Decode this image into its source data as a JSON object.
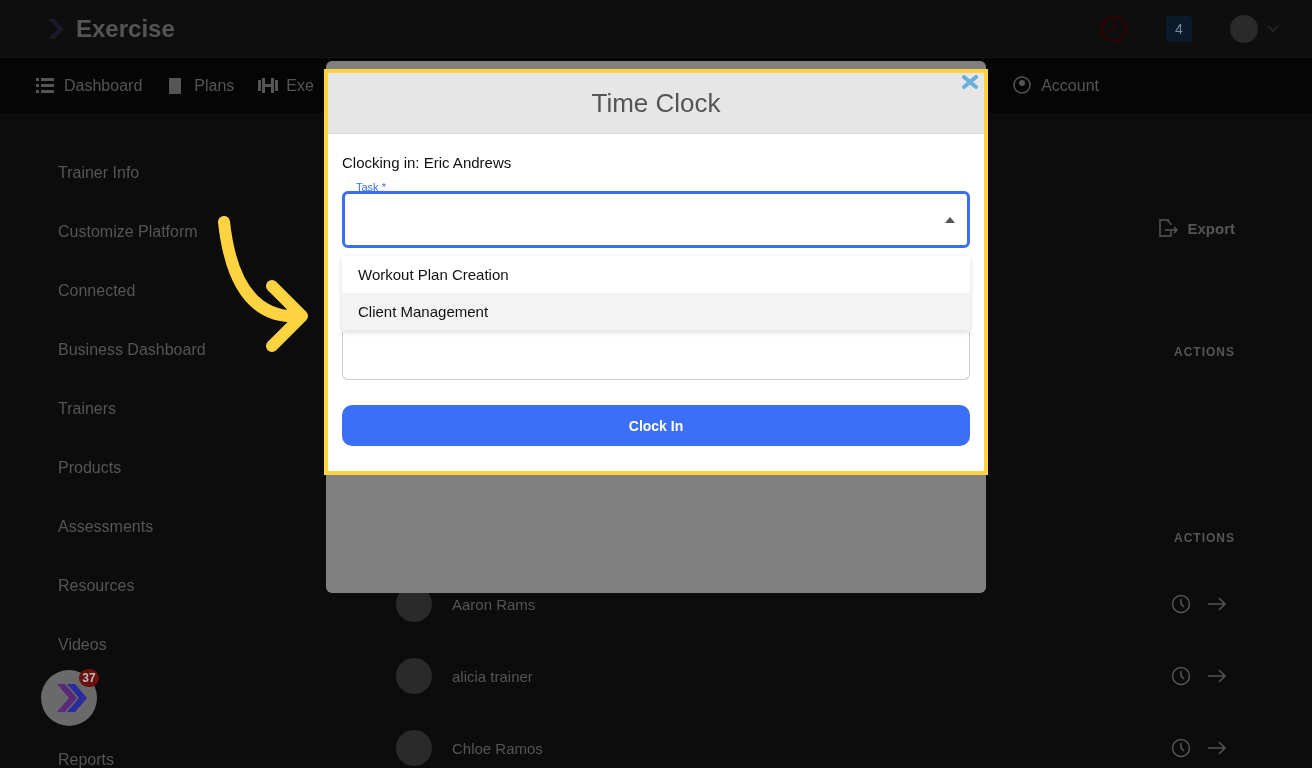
{
  "header": {
    "brand": "Exercise",
    "notification_count": "4"
  },
  "nav": [
    {
      "label": "Dashboard",
      "kind": "list"
    },
    {
      "label": "Plans",
      "kind": "clipboard"
    },
    {
      "label": "Exe",
      "kind": "dumbbell"
    },
    {
      "label": "Account",
      "kind": "person"
    }
  ],
  "sidebar": {
    "items": [
      "Trainer Info",
      "Customize Platform",
      "Connected",
      "Business Dashboard",
      "Trainers",
      "Products",
      "Assessments",
      "Resources",
      "Videos",
      "Reports"
    ]
  },
  "main": {
    "export_label": "Export",
    "tables": [
      {
        "actions_header": "ACTIONS"
      },
      {
        "actions_header": "ACTIONS",
        "rows": [
          "Aaron Rams",
          "alicia trainer",
          "Chloe Ramos"
        ]
      }
    ]
  },
  "chat": {
    "badge": "37"
  },
  "modal": {
    "title": "Time Clock",
    "subtitle": "Clocking in: Eric Andrews",
    "task_field": {
      "label": "Task *",
      "expanded": true
    },
    "options": [
      {
        "label": "Workout Plan Creation",
        "selected": false
      },
      {
        "label": "Client Management",
        "selected": true
      }
    ],
    "button": "Clock In"
  }
}
